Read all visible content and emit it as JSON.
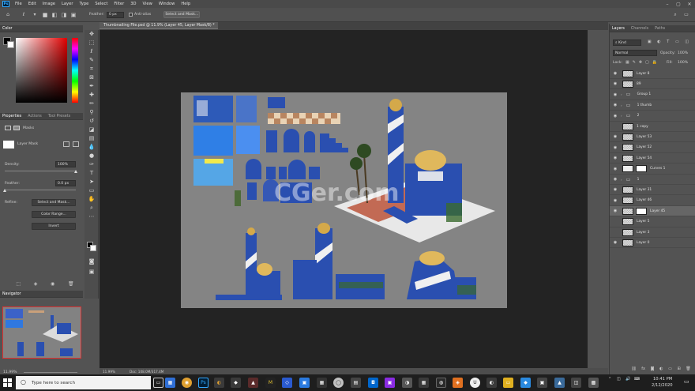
{
  "menu": [
    "File",
    "Edit",
    "Image",
    "Layer",
    "Type",
    "Select",
    "Filter",
    "3D",
    "View",
    "Window",
    "Help"
  ],
  "app_badge": "Ps",
  "options": {
    "feather_label": "Feather:",
    "feather_value": "0 px",
    "antialias_label": "Anti-alias",
    "select_mask": "Select and Mask..."
  },
  "color_panel": {
    "title": "Color"
  },
  "properties": {
    "tabs": [
      "Properties",
      "Actions",
      "Tool Presets"
    ],
    "masks_label": "Masks",
    "layer_mask_label": "Layer Mask",
    "density_label": "Density:",
    "density_value": "100%",
    "density_level": 1.0,
    "feather_label": "Feather:",
    "feather_value": "0.0 px",
    "feather_level": 0.0,
    "refine_label": "Refine:",
    "select_mask_btn": "Select and Mask...",
    "color_range_btn": "Color Range...",
    "invert_btn": "Invert"
  },
  "navigator": {
    "title": "Navigator",
    "zoom": "11.99%"
  },
  "document": {
    "tab_title": "Thumbnailing File.psd @ 11.9% (Layer 45, Layer Mask/8) *",
    "status_zoom": "11.99%",
    "status_doc": "Doc: 108.0M/317.4M",
    "watermark": "CGer.com"
  },
  "layers_panel": {
    "tabs": [
      "Layers",
      "Channels",
      "Paths"
    ],
    "kind": "Kind",
    "blend": "Normal",
    "opacity_label": "Opacity:",
    "opacity_value": "100%",
    "lock_label": "Lock:",
    "fill_label": "Fill:",
    "fill_value": "100%",
    "layers": [
      {
        "name": "Layer 8",
        "kind": "layer",
        "visible": true
      },
      {
        "name": "89",
        "kind": "layer",
        "visible": true
      },
      {
        "name": "Group 1",
        "kind": "group",
        "visible": true
      },
      {
        "name": "1 thumb",
        "kind": "group",
        "visible": true
      },
      {
        "name": "2",
        "kind": "group",
        "visible": true
      },
      {
        "name": "1 copy",
        "kind": "layer",
        "visible": false
      },
      {
        "name": "Layer 53",
        "kind": "layer",
        "visible": true
      },
      {
        "name": "Layer 52",
        "kind": "layer",
        "visible": true
      },
      {
        "name": "Layer 54",
        "kind": "layer",
        "visible": true
      },
      {
        "name": "Curves 1",
        "kind": "adjust",
        "visible": true
      },
      {
        "name": "1",
        "kind": "group",
        "visible": true
      },
      {
        "name": "Layer 31",
        "kind": "layer",
        "visible": true
      },
      {
        "name": "Layer 46",
        "kind": "layer",
        "visible": true
      },
      {
        "name": "Layer 45",
        "kind": "masked",
        "visible": true
      },
      {
        "name": "Layer 5",
        "kind": "layer",
        "visible": false
      },
      {
        "name": "Layer 3",
        "kind": "layer",
        "visible": false
      },
      {
        "name": "Layer 0",
        "kind": "layer",
        "visible": true
      }
    ]
  },
  "taskbar": {
    "search_placeholder": "Type here to search",
    "time": "10:41 PM",
    "date": "2/12/2020"
  },
  "colors": {
    "accent": "#31a8ff",
    "blue_art": "#2a4fb0",
    "canvas_bg": "#232323"
  }
}
